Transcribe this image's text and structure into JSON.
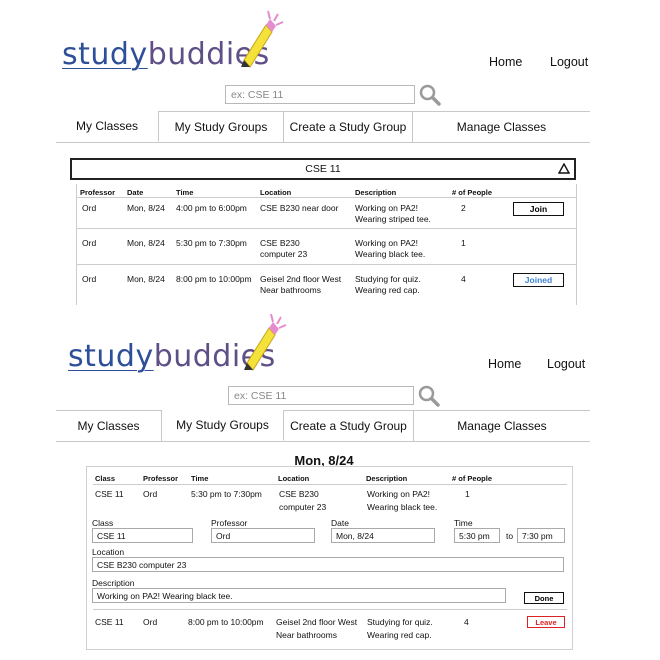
{
  "logo": {
    "part1": "study",
    "part2": "buddies"
  },
  "nav": {
    "home": "Home",
    "logout": "Logout"
  },
  "search": {
    "placeholder": "ex: CSE 11"
  },
  "tabs": [
    "My Classes",
    "My Study Groups",
    "Create a Study Group",
    "Manage Classes"
  ],
  "panel1": {
    "active_tab": "My Classes",
    "class_title": "CSE 11",
    "headers": [
      "Professor",
      "Date",
      "Time",
      "Location",
      "Description",
      "# of People"
    ],
    "rows": [
      {
        "professor": "Ord",
        "date": "Mon, 8/24",
        "time": "4:00 pm to 6:00pm",
        "location": [
          "CSE B230 near door"
        ],
        "description": [
          "Working on PA2!",
          "Wearing striped tee."
        ],
        "people": "2",
        "action": "Join"
      },
      {
        "professor": "Ord",
        "date": "Mon, 8/24",
        "time": "5:30 pm to 7:30pm",
        "location": [
          "CSE B230",
          "computer 23"
        ],
        "description": [
          "Working on PA2!",
          "Wearing black tee."
        ],
        "people": "1",
        "action": ""
      },
      {
        "professor": "Ord",
        "date": "Mon, 8/24",
        "time": "8:00 pm to 10:00pm",
        "location": [
          "Geisel 2nd floor West",
          "Near bathrooms"
        ],
        "description": [
          "Studying for quiz.",
          "Wearing red cap."
        ],
        "people": "4",
        "action": "Joined"
      }
    ]
  },
  "panel2": {
    "active_tab": "My Study Groups",
    "date_title": "Mon, 8/24",
    "headers": [
      "Class",
      "Professor",
      "Time",
      "Location",
      "Description",
      "# of People"
    ],
    "row1": {
      "class": "CSE 11",
      "professor": "Ord",
      "time": "5:30 pm to 7:30pm",
      "location": [
        "CSE B230",
        "computer 23"
      ],
      "description": [
        "Working on PA2!",
        "Wearing black tee."
      ],
      "people": "1"
    },
    "form": {
      "class_label": "Class",
      "class_value": "CSE 11",
      "professor_label": "Professor",
      "professor_value": "Ord",
      "date_label": "Date",
      "date_value": "Mon, 8/24",
      "time_label": "Time",
      "time_start": "5:30 pm",
      "to": "to",
      "time_end": "7:30 pm",
      "location_label": "Location",
      "location_value": "CSE B230 computer 23",
      "description_label": "Description",
      "description_value": "Working on PA2! Wearing black tee.",
      "done": "Done"
    },
    "row2": {
      "class": "CSE 11",
      "professor": "Ord",
      "time": "8:00 pm to 10:00pm",
      "location": [
        "Geisel 2nd floor West",
        "Near bathrooms"
      ],
      "description": [
        "Studying for quiz.",
        "Wearing red cap."
      ],
      "people": "4",
      "action": "Leave"
    }
  },
  "colors": {
    "logo_study": "#2d4f9a",
    "logo_buddies": "#5e4f86",
    "pencil": "#f4e23a",
    "pencil_tip": "#e58ccf",
    "joined": "#3b82d6",
    "leave": "#dd2222"
  },
  "icons": [
    "pencil-logo-icon",
    "search-icon",
    "collapse-triangle-icon"
  ]
}
